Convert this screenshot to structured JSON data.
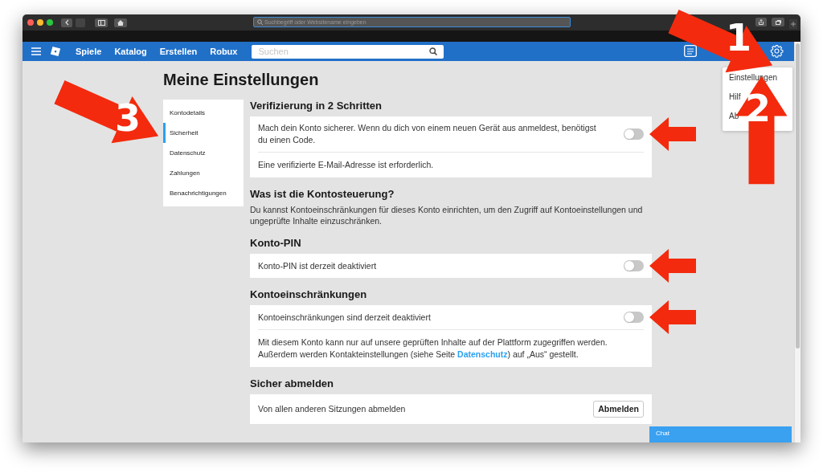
{
  "browser": {
    "address_placeholder": "Suchbegriff oder Websitename eingeben"
  },
  "navbar": {
    "links": [
      "Spiele",
      "Katalog",
      "Erstellen",
      "Robux"
    ],
    "search": {
      "placeholder": "Suchen"
    }
  },
  "settings_menu": {
    "items": [
      {
        "label": "Einstellungen"
      },
      {
        "label": "Hilf"
      },
      {
        "label": "Ab"
      }
    ]
  },
  "page_title": "Meine Einstellungen",
  "sidebar": {
    "items": [
      {
        "label": "Kontodetails",
        "selected": false
      },
      {
        "label": "Sicherheit",
        "selected": true
      },
      {
        "label": "Datenschutz",
        "selected": false
      },
      {
        "label": "Zahlungen",
        "selected": false
      },
      {
        "label": "Benachrichtigungen",
        "selected": false
      }
    ]
  },
  "sections": [
    {
      "title": "Verifizierung in 2 Schritten",
      "items": [
        {
          "kind": "toggle",
          "text": "Mach dein Konto sicherer. Wenn du dich von einem neuen Gerät aus anmeldest, benötigst du einen Code.",
          "on": false,
          "highlighted": true
        },
        {
          "kind": "note",
          "text": "Eine verifizierte E-Mail-Adresse ist erforderlich."
        }
      ]
    },
    {
      "title": "Was ist die Kontosteuerung?",
      "items": [
        {
          "kind": "paragraph",
          "text": "Du kannst Kontoeinschränkungen für dieses Konto einrichten, um den Zugriff auf Kontoeinstellungen und ungeprüfte Inhalte einzuschränken."
        }
      ]
    },
    {
      "title": "Konto-PIN",
      "items": [
        {
          "kind": "toggle",
          "text": "Konto-PIN ist derzeit deaktiviert",
          "on": false,
          "highlighted": true
        }
      ]
    },
    {
      "title": "Kontoeinschränkungen",
      "items": [
        {
          "kind": "toggle",
          "text": "Kontoeinschränkungen sind derzeit deaktiviert",
          "on": false,
          "highlighted": true
        },
        {
          "kind": "note",
          "text": "Mit diesem Konto kann nur auf unsere geprüften Inhalte auf der Plattform zugegriffen werden. Außerdem werden Kontakteinstellungen (siehe Seite ",
          "link": "Datenschutz",
          "text_after": ") auf „Aus“ gestellt."
        }
      ]
    },
    {
      "title": "Sicher abmelden",
      "items": [
        {
          "kind": "button",
          "text": "Von allen anderen Sitzungen abmelden",
          "button": "Abmelden"
        }
      ]
    }
  ],
  "chat": {
    "label": "Chat"
  },
  "annotations": [
    {
      "label": "1"
    },
    {
      "label": "2"
    },
    {
      "label": "3"
    }
  ]
}
